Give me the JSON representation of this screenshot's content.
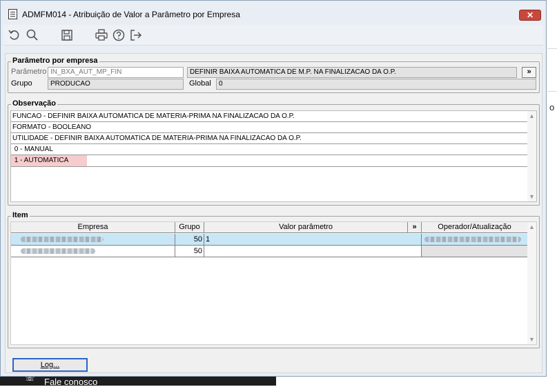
{
  "window": {
    "title": "ADMFM014 - Atribuição de Valor a Parâmetro por Empresa",
    "close_glyph": "✕"
  },
  "toolbar": {
    "icons": [
      "undo-icon",
      "search-icon",
      "save-icon",
      "print-icon",
      "help-icon",
      "exit-icon"
    ]
  },
  "parametro": {
    "section_title": "Parâmetro por empresa",
    "parametro_label": "Parâmetro",
    "parametro_value": "IN_BXA_AUT_MP_FIN",
    "descricao_value": "DEFINIR BAIXA AUTOMATICA DE M.P. NA FINALIZACAO DA O.P.",
    "expand_label": "»",
    "grupo_label": "Grupo",
    "grupo_value": "PRODUCAO",
    "global_label": "Global",
    "global_value": "0"
  },
  "observacao": {
    "section_title": "Observação",
    "rows": [
      "FUNCAO - DEFINIR BAIXA AUTOMATICA DE MATERIA-PRIMA NA FINALIZACAO DA O.P.",
      "FORMATO - BOOLEANO",
      "UTILIDADE - DEFINIR BAIXA AUTOMATICA DE MATERIA-PRIMA NA FINALIZACAO DA O.P.",
      " 0 - MANUAL",
      " 1 - AUTOMATICA"
    ]
  },
  "item": {
    "section_title": "Item",
    "columns": {
      "empresa": "Empresa",
      "grupo": "Grupo",
      "valor": "Valor parâmetro",
      "expand": "»",
      "operador": "Operador/Atualização"
    },
    "rows": [
      {
        "grupo": "50",
        "valor": "1"
      },
      {
        "grupo": "50",
        "valor": ""
      }
    ]
  },
  "footer": {
    "log_label": "Log..."
  },
  "background": {
    "bottom_text": "Fale conosco",
    "side_glyph": "o",
    "colors": {
      "selected_row": "#c8e6f6",
      "highlight_row": "#f6cccc",
      "close_button": "#c9483b"
    }
  }
}
